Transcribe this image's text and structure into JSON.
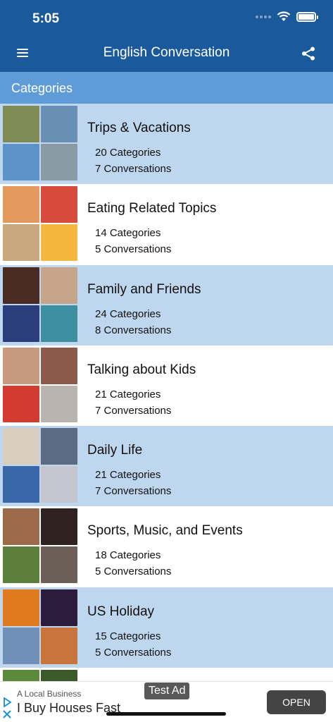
{
  "status": {
    "time": "5:05"
  },
  "nav": {
    "title": "English Conversation",
    "menu_icon": "hamburger-menu-icon",
    "share_icon": "share-icon"
  },
  "section": {
    "title": "Categories"
  },
  "rows": [
    {
      "title": "Trips & Vacations",
      "categories": "20 Categories",
      "conversations": "7 Conversations",
      "thumb_colors": [
        "#7f8a55",
        "#6a8fb4",
        "#5b94c9",
        "#8a9aa4"
      ]
    },
    {
      "title": "Eating Related Topics",
      "categories": "14 Categories",
      "conversations": "5 Conversations",
      "thumb_colors": [
        "#e39a5c",
        "#d84b3c",
        "#c9a77f",
        "#f2b73c"
      ]
    },
    {
      "title": "Family and Friends",
      "categories": "24 Categories",
      "conversations": "8 Conversations",
      "thumb_colors": [
        "#4a2c24",
        "#c7a58b",
        "#2b3d7a",
        "#3e8fa0"
      ]
    },
    {
      "title": "Talking about Kids",
      "categories": "21 Categories",
      "conversations": "7 Conversations",
      "thumb_colors": [
        "#c79a80",
        "#8c5a4a",
        "#d33b30",
        "#b9b4ae"
      ]
    },
    {
      "title": "Daily Life",
      "categories": "21 Categories",
      "conversations": "7 Conversations",
      "thumb_colors": [
        "#d9cdc0",
        "#5b6b84",
        "#3967a8",
        "#c4c6d0"
      ]
    },
    {
      "title": "Sports, Music, and Events",
      "categories": "18 Categories",
      "conversations": "5 Conversations",
      "thumb_colors": [
        "#9c6a48",
        "#2f2220",
        "#5c7f3c",
        "#6b5f58"
      ]
    },
    {
      "title": "US Holiday",
      "categories": "15 Categories",
      "conversations": "5 Conversations",
      "thumb_colors": [
        "#e07a1f",
        "#2a1c3a",
        "#6f8fb8",
        "#c9743a"
      ]
    },
    {
      "title": "",
      "categories": "",
      "conversations": "",
      "thumb_colors": [
        "#5a8a3a",
        "#3a5a2a",
        "#ffffff",
        "#ffffff"
      ]
    }
  ],
  "ad": {
    "label": "Test Ad",
    "business": "A Local Business",
    "headline": "I Buy Houses Fast",
    "cta": "OPEN"
  }
}
